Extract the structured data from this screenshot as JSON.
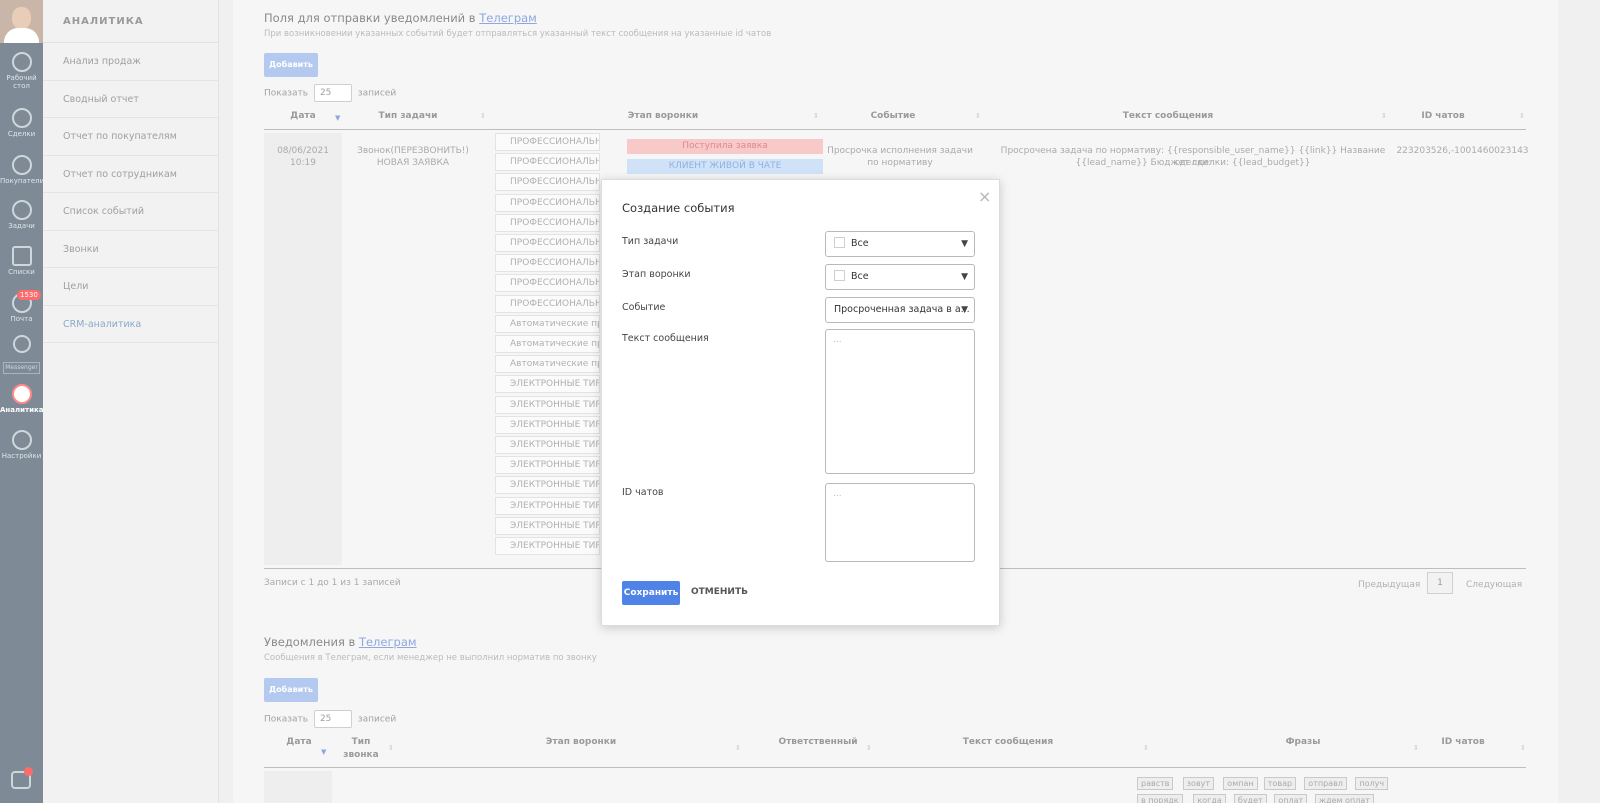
{
  "rail": {
    "items": [
      {
        "label": "Рабочий стол",
        "icon": "dashboard-icon"
      },
      {
        "label": "Сделки",
        "icon": "dollar-icon"
      },
      {
        "label": "Покупатели",
        "icon": "customers-icon"
      },
      {
        "label": "Задачи",
        "icon": "check-icon"
      },
      {
        "label": "Списки",
        "icon": "list-icon"
      },
      {
        "label": "Почта",
        "icon": "mail-icon"
      },
      {
        "label": "Аналитика",
        "icon": "analytics-icon"
      },
      {
        "label": "Настройки",
        "icon": "settings-icon"
      }
    ],
    "mail_badge": "1530",
    "messenger_label": "Messenger"
  },
  "menu": {
    "title": "АНАЛИТИКА",
    "items": [
      "Анализ продаж",
      "Сводный отчет",
      "Отчет по покупателям",
      "Отчет по сотрудникам",
      "Список событий",
      "Звонки",
      "Цели",
      "CRM-аналитика"
    ]
  },
  "section1": {
    "title": "Поля для отправки уведомлений в ",
    "title_link": "Телеграм",
    "subtitle": "При возникновении указанных событий будет отправляться указанный текст сообщения на указанные id чатов",
    "add_label": "Добавить",
    "show_label": "Показать",
    "show_value": "25",
    "records_label": "записей",
    "headers": [
      "Дата",
      "Тип задачи",
      "Этап воронки",
      "Событие",
      "Текст сообщения",
      "ID чатов"
    ],
    "row": {
      "date": "08/06/2021",
      "time": "10:19",
      "task_type": "Звонок(ПЕРЕЗВОНИТЬ!)",
      "task_type_2": "НОВАЯ ЗАЯВКА",
      "stages": [
        "ПРОФЕССИОНАЛЬНЫЕ",
        "ПРОФЕССИОНАЛЬНЫЕ",
        "ПРОФЕССИОНАЛЬНЫЕ",
        "ПРОФЕССИОНАЛЬНЫЕ",
        "ПРОФЕССИОНАЛЬНЫЕ",
        "ПРОФЕССИОНАЛЬНЫЕ",
        "ПРОФЕССИОНАЛЬНЫЕ",
        "ПРОФЕССИОНАЛЬНЫЕ",
        "ПРОФЕССИОНАЛЬНЫЕ",
        "Автоматические продажи",
        "Автоматические продажи",
        "Автоматические продажи",
        "ЭЛЕКТРОННЫЕ ТИРАЖИ",
        "ЭЛЕКТРОННЫЕ ТИРАЖИ",
        "ЭЛЕКТРОННЫЕ ТИРАЖИ",
        "ЭЛЕКТРОННЫЕ ТИРАЖИ",
        "ЭЛЕКТРОННЫЕ ТИРАЖИ",
        "ЭЛЕКТРОННЫЕ ТИРАЖИ",
        "ЭЛЕКТРОННЫЕ ТИРАЖИ",
        "ЭЛЕКТРОННЫЕ ТИРАЖИ",
        "ЭЛЕКТРОННЫЕ ТИРАЖИ"
      ],
      "badge_1": "Поступила заявка",
      "badge_1_color": "#f8c9c9",
      "badge_2": "КЛИЕНТ ЖИВОЙ В ЧАТЕ",
      "badge_2_color": "#cfe2f7",
      "event_1": "Просрочка исполнения задачи",
      "event_2": "по нормативу",
      "message_1": "Просрочена задача по нормативу: {{responsible_user_name}} {{link}} Название сделки:",
      "message_2": "{{lead_name}} Бюджет сделки: {{lead_budget}}",
      "chat_ids": "223203526,-1001460023143"
    },
    "info": "Записи с 1 до 1 из 1 записей",
    "prev_label": "Предыдущая",
    "page": "1",
    "next_label": "Следующая"
  },
  "section2": {
    "title": "Уведомления в ",
    "title_link": "Телеграм",
    "subtitle": "Сообщения в Телеграм, если менеджер не выполнил норматив по звонку",
    "add_label": "Добавить",
    "show_label": "Показать",
    "show_value": "25",
    "records_label": "записей",
    "headers": [
      "Дата",
      "Тип",
      "звонка",
      "Этап воронки",
      "Ответственный",
      "Текст сообщения",
      "Фразы",
      "ID чатов"
    ],
    "phrases_row1": [
      "равств",
      "зовут",
      "омпан",
      "товар",
      "отправл",
      "получ"
    ],
    "phrases_row2": [
      "в порядк",
      "когда",
      "будет",
      "оплат",
      "ждем оплат"
    ]
  },
  "modal": {
    "title": "Создание события",
    "close": "×",
    "task_type_label": "Тип задачи",
    "task_type_value": "Все",
    "stage_label": "Этап воронки",
    "stage_value": "Все",
    "event_label": "Событие",
    "event_value": "Просроченная задача в а...",
    "text_label": "Текст сообщения",
    "text_placeholder": "...",
    "ids_label": "ID чатов",
    "ids_placeholder": "...",
    "save_label": "Сохранить",
    "cancel_label": "ОТМЕНИТЬ"
  }
}
